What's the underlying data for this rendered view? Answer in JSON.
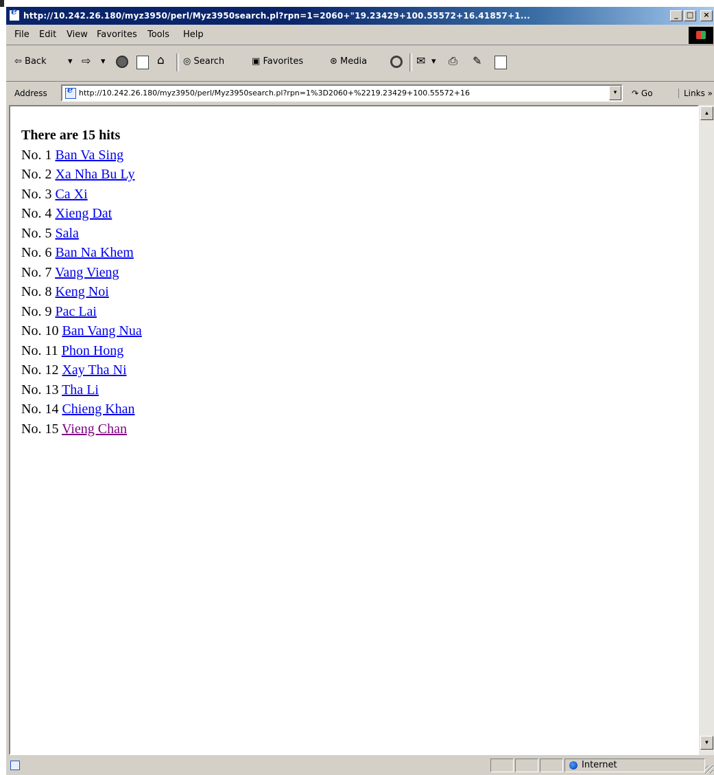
{
  "window": {
    "title": "http://10.242.26.180/myz3950/perl/Myz3950search.pl?rpn=1=2060+\"19.23429+100.55572+16.41857+1...",
    "controls": {
      "minimize": "_",
      "maximize": "□",
      "close": "×"
    }
  },
  "menu": [
    "File",
    "Edit",
    "View",
    "Favorites",
    "Tools",
    "Help"
  ],
  "toolbar": {
    "back": "Back",
    "forward_arrow": "⇨",
    "dropdown_glyph": "▾",
    "search": "Search",
    "favorites": "Favorites",
    "media": "Media"
  },
  "address": {
    "label": "Address",
    "url": "http://10.242.26.180/myz3950/perl/Myz3950search.pl?rpn=1%3D2060+%2219.23429+100.55572+16",
    "go": "Go",
    "links": "Links",
    "dropdown_glyph": "▾",
    "more_glyph": "»"
  },
  "page": {
    "heading": "There are 15 hits",
    "results": [
      {
        "num": "No. 1",
        "name": "Ban Va Sing",
        "visited": false
      },
      {
        "num": "No. 2",
        "name": "Xa Nha Bu Ly",
        "visited": false
      },
      {
        "num": "No. 3",
        "name": "Ca Xi",
        "visited": false
      },
      {
        "num": "No. 4",
        "name": "Xieng Dat",
        "visited": false
      },
      {
        "num": "No. 5",
        "name": "Sala",
        "visited": false
      },
      {
        "num": "No. 6",
        "name": "Ban Na Khem",
        "visited": false
      },
      {
        "num": "No. 7",
        "name": "Vang Vieng",
        "visited": false
      },
      {
        "num": "No. 8",
        "name": "Keng Noi",
        "visited": false
      },
      {
        "num": "No. 9",
        "name": "Pac Lai",
        "visited": false
      },
      {
        "num": "No. 10",
        "name": "Ban Vang Nua",
        "visited": false
      },
      {
        "num": "No. 11",
        "name": "Phon Hong",
        "visited": false
      },
      {
        "num": "No. 12",
        "name": "Xay Tha Ni",
        "visited": false
      },
      {
        "num": "No. 13",
        "name": "Tha Li",
        "visited": false
      },
      {
        "num": "No. 14",
        "name": "Chieng Khan",
        "visited": false
      },
      {
        "num": "No. 15",
        "name": "Vieng Chan",
        "visited": true
      }
    ]
  },
  "scrollbar": {
    "up_glyph": "▲",
    "down_glyph": "▼"
  },
  "status": {
    "zone": "Internet"
  },
  "colors": {
    "link": "#0000ee",
    "visited_link": "#800080",
    "titlebar": "#0a246a",
    "chrome": "#d4d0c8"
  },
  "icons": [
    "ie-page-icon",
    "stop-icon",
    "refresh-icon",
    "home-icon",
    "search-icon",
    "favorites-icon",
    "media-icon",
    "history-icon",
    "mail-icon",
    "print-icon",
    "edit-icon",
    "discuss-icon",
    "go-icon",
    "globe-icon",
    "windows-logo-icon"
  ]
}
